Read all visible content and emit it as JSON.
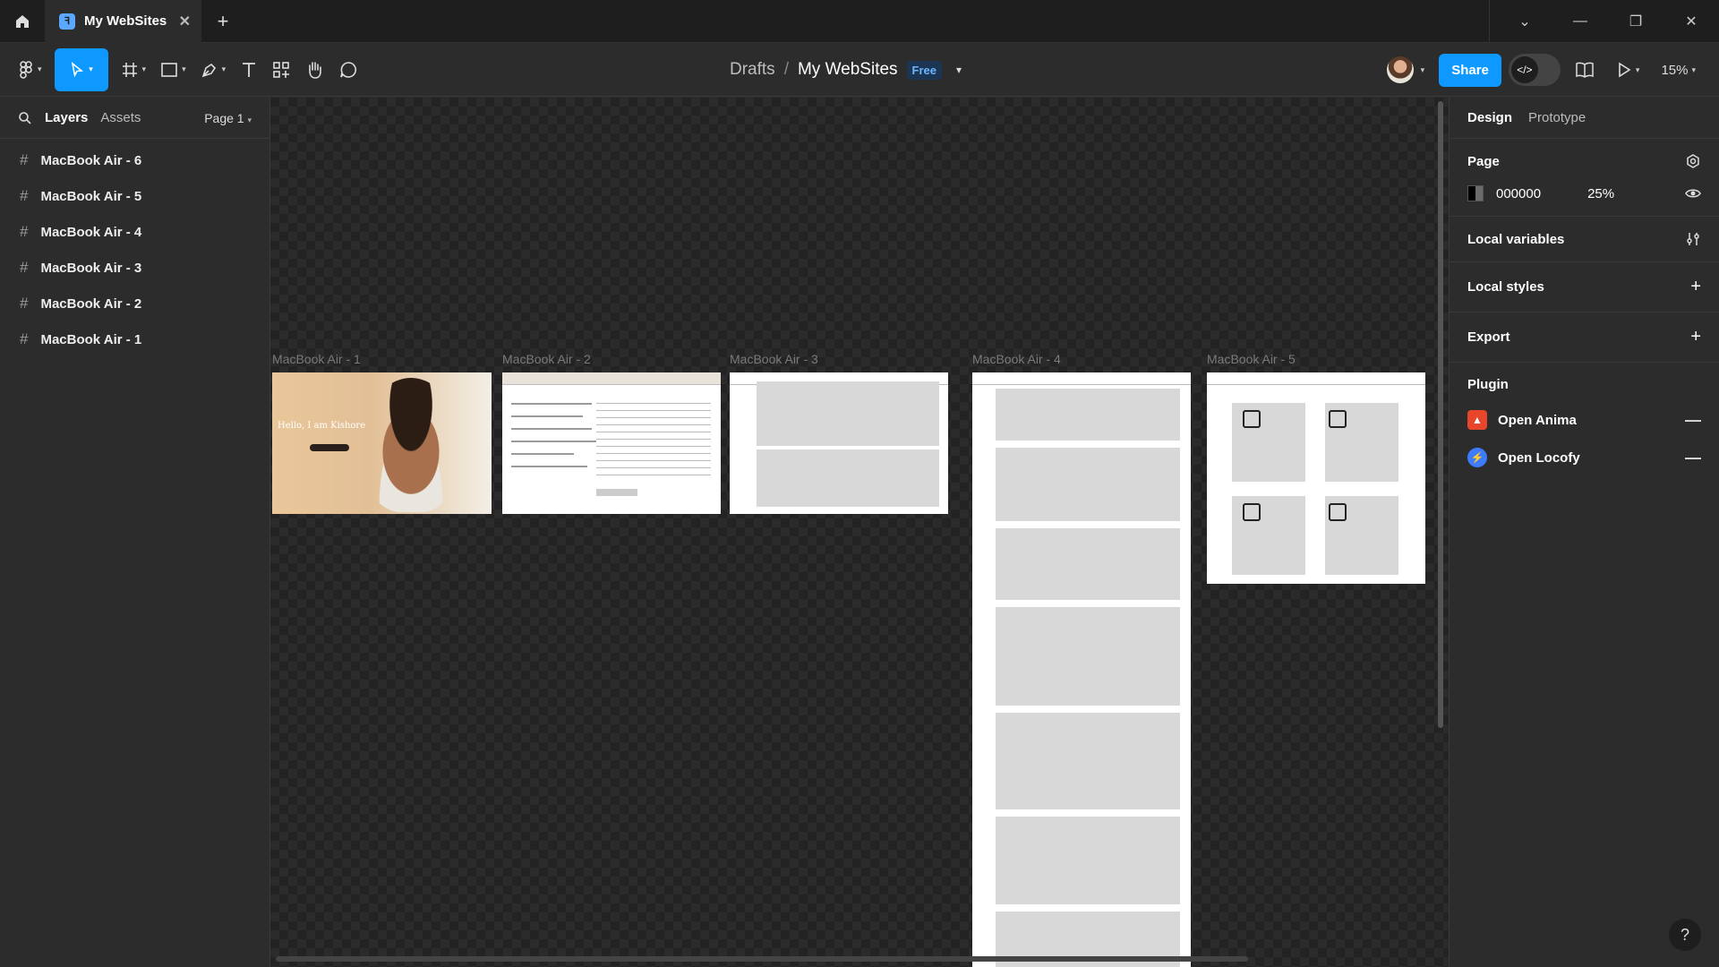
{
  "titlebar": {
    "tab_title": "My WebSites",
    "tab_close": "✕",
    "new_tab": "+",
    "window_controls": [
      "⌄",
      "—",
      "❐",
      "✕"
    ]
  },
  "toolbar": {
    "breadcrumb_drafts": "Drafts",
    "breadcrumb_sep": "/",
    "file_name": "My WebSites",
    "plan_badge": "Free",
    "share_label": "Share",
    "zoom": "15%",
    "accent": "#0d99ff"
  },
  "left_panel": {
    "tab_layers": "Layers",
    "tab_assets": "Assets",
    "page_select": "Page 1",
    "layers": [
      {
        "label": "MacBook Air - 6"
      },
      {
        "label": "MacBook Air - 5"
      },
      {
        "label": "MacBook Air - 4"
      },
      {
        "label": "MacBook Air - 3"
      },
      {
        "label": "MacBook Air - 2"
      },
      {
        "label": "MacBook Air - 1"
      }
    ]
  },
  "canvas": {
    "frames": [
      {
        "label": "MacBook Air - 1",
        "hello_text": "Hello, I am Kishore"
      },
      {
        "label": "MacBook Air - 2"
      },
      {
        "label": "MacBook Air - 3"
      },
      {
        "label": "MacBook Air - 4"
      },
      {
        "label": "MacBook Air - 5"
      }
    ]
  },
  "right_panel": {
    "tab_design": "Design",
    "tab_prototype": "Prototype",
    "page_heading": "Page",
    "page_color": "000000",
    "page_opacity": "25%",
    "local_variables": "Local variables",
    "local_styles": "Local styles",
    "export": "Export",
    "plugin_heading": "Plugin",
    "plugins": [
      {
        "name": "Open Anima",
        "color": "#e8462b"
      },
      {
        "name": "Open Locofy",
        "color": "#3d7bff"
      }
    ],
    "help": "?"
  }
}
